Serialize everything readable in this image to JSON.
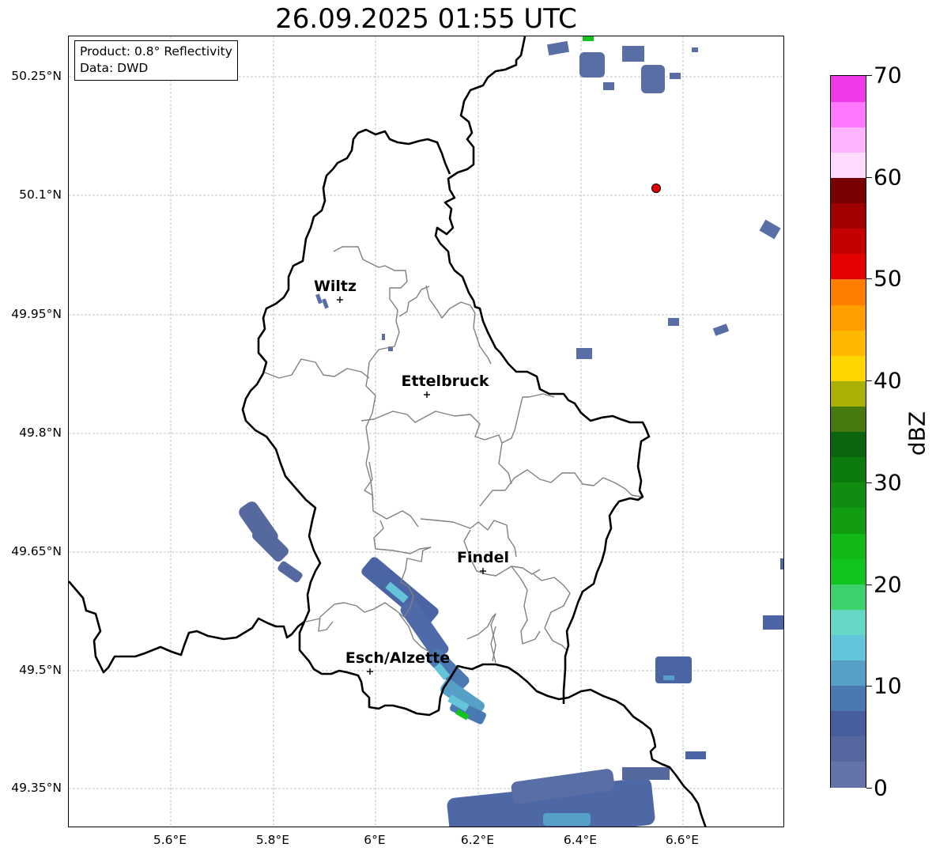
{
  "title": "26.09.2025 01:55 UTC",
  "info": {
    "product": "Product: 0.8° Reflectivity",
    "data": "Data: DWD"
  },
  "axes": {
    "lat_labels": [
      "50.25°N",
      "50.1°N",
      "49.95°N",
      "49.8°N",
      "49.65°N",
      "49.5°N",
      "49.35°N"
    ],
    "lon_labels": [
      "5.6°E",
      "5.8°E",
      "6°E",
      "6.2°E",
      "6.4°E",
      "6.6°E"
    ]
  },
  "cities": [
    {
      "name": "Wiltz"
    },
    {
      "name": "Ettelbruck"
    },
    {
      "name": "Findel"
    },
    {
      "name": "Esch/Alzette"
    }
  ],
  "colorbar": {
    "label": "dBZ",
    "min": 0,
    "max": 70,
    "ticks": [
      "0",
      "10",
      "20",
      "30",
      "40",
      "50",
      "60",
      "70"
    ],
    "colors": [
      "#6474a8",
      "#5667a0",
      "#465d9e",
      "#4a78b0",
      "#56a0c8",
      "#64c4da",
      "#64d8c4",
      "#3ed26c",
      "#12c41e",
      "#12b816",
      "#129c12",
      "#108c10",
      "#0c7a0c",
      "#0a6410",
      "#467a10",
      "#aab004",
      "#ffd600",
      "#ffb800",
      "#ff9e00",
      "#ff7e00",
      "#e40000",
      "#c40000",
      "#a00000",
      "#780000",
      "#ffdcff",
      "#ffb4ff",
      "#ff78ff",
      "#ee3ae8"
    ]
  },
  "colors": {
    "border": "#000000",
    "canton": "#808080",
    "grid": "#b4b4b4",
    "radar_site": "#e00000"
  }
}
